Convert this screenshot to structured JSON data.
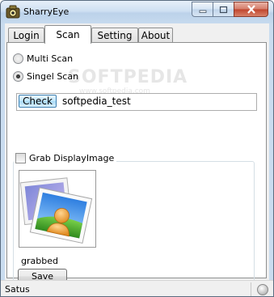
{
  "window": {
    "title": "SharryEye",
    "icon": "camera-eye-icon",
    "controls": [
      "minimize-icon",
      "maximize-icon",
      "close-icon"
    ]
  },
  "tabs": [
    {
      "label": "Login",
      "active": false
    },
    {
      "label": "Scan",
      "active": true
    },
    {
      "label": "Setting",
      "active": false
    },
    {
      "label": "About",
      "active": false
    }
  ],
  "watermark": {
    "main": "SOFTPEDIA",
    "sub": "www.softpedia.com"
  },
  "scan": {
    "multi_scan_label": "Multi Scan",
    "single_scan_label": "Singel Scan",
    "selected_mode": "Singel Scan",
    "check_label": "Check",
    "check_value": "softpedia_test"
  },
  "grab": {
    "group_label": "Grab DisplayImage",
    "checked": false,
    "picture_icon": "image-placeholder-icon",
    "status_text": "grabbed",
    "save_label": "Save"
  },
  "statusbar": {
    "text": "Satus",
    "indicator": "status-led-icon"
  },
  "colors": {
    "accent": "#3c7fb1",
    "title_bar": "#c6daee",
    "close_button": "#c0442c"
  }
}
